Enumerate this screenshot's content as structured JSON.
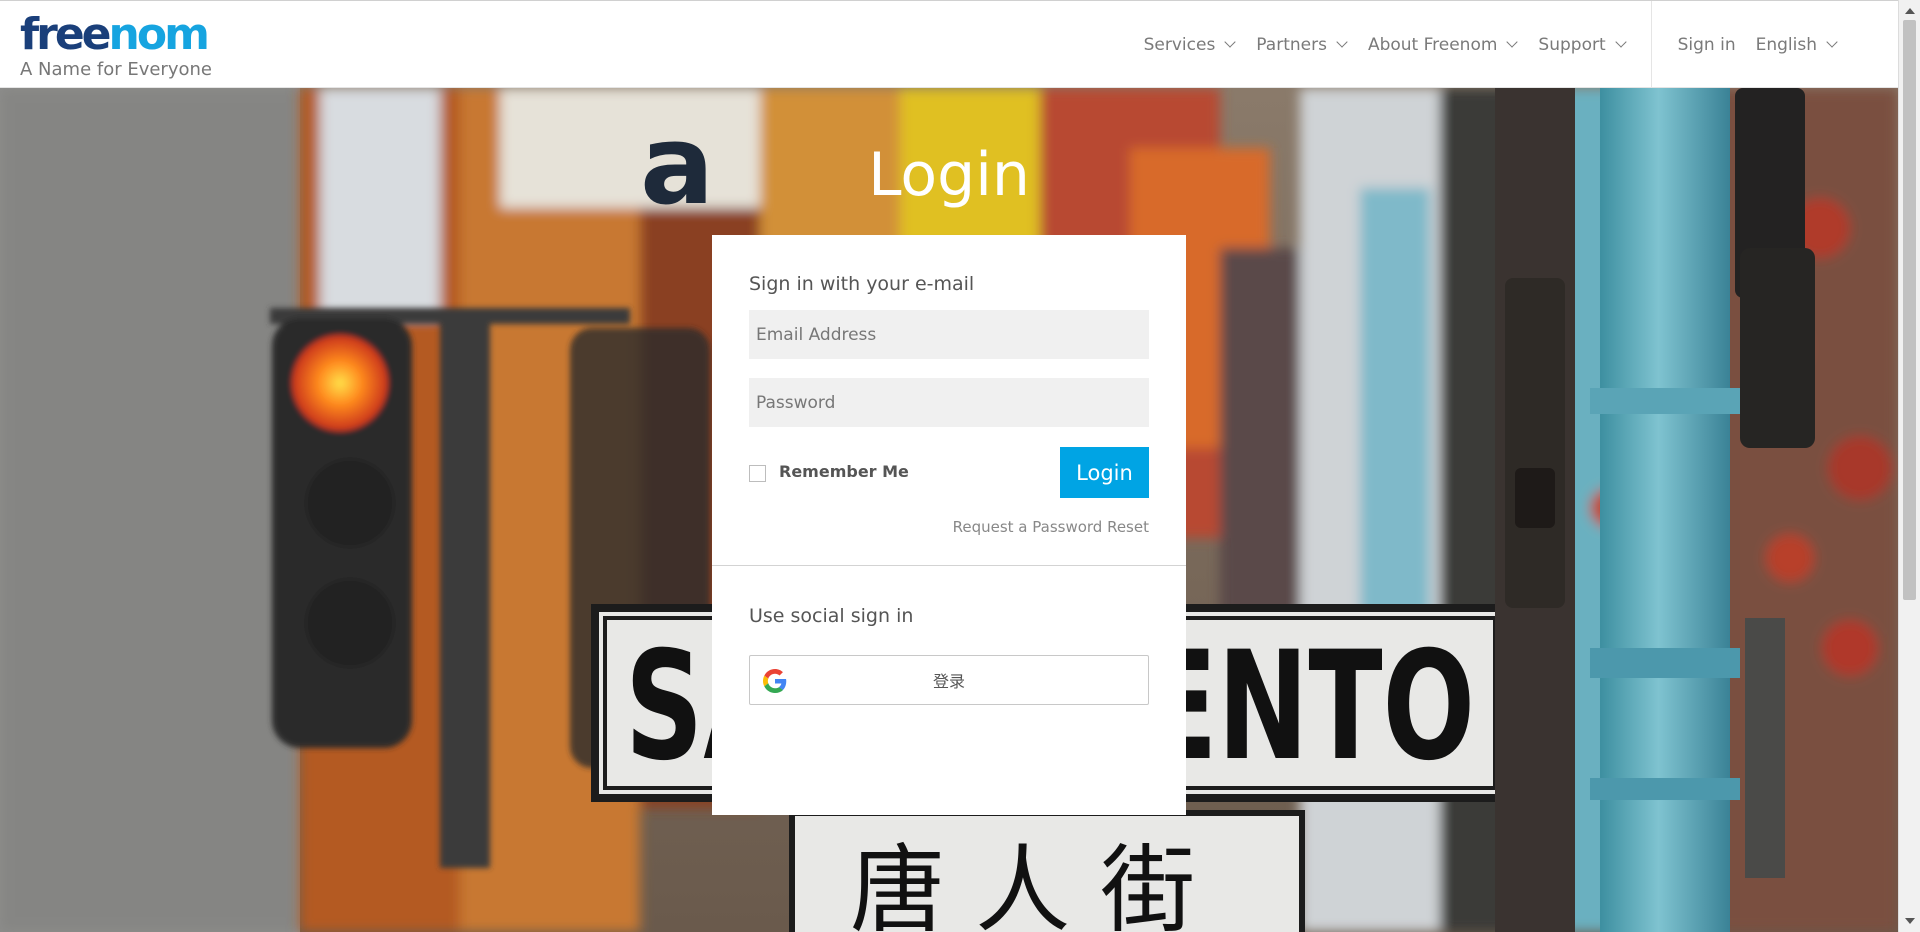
{
  "brand": {
    "logo_part1": "free",
    "logo_part2": "nom",
    "tagline": "A Name for Everyone",
    "colors": {
      "logo_dark": "#1a3f7a",
      "logo_light": "#16a4e0",
      "accent": "#00a4e4"
    }
  },
  "nav": {
    "items": [
      {
        "label": "Services",
        "icon": "chevron-down-icon"
      },
      {
        "label": "Partners",
        "icon": "chevron-down-icon"
      },
      {
        "label": "About Freenom",
        "icon": "chevron-down-icon"
      },
      {
        "label": "Support",
        "icon": "chevron-down-icon"
      }
    ],
    "signin": "Sign in",
    "language": "English"
  },
  "login": {
    "title": "Login",
    "email_section_title": "Sign in with your e-mail",
    "email_placeholder": "Email Address",
    "password_placeholder": "Password",
    "remember_label": "Remember Me",
    "remember_checked": false,
    "submit_label": "Login",
    "reset_link": "Request a Password Reset",
    "social_section_title": "Use social sign in",
    "google_label": "登录",
    "google_icon": "google-g-icon"
  }
}
